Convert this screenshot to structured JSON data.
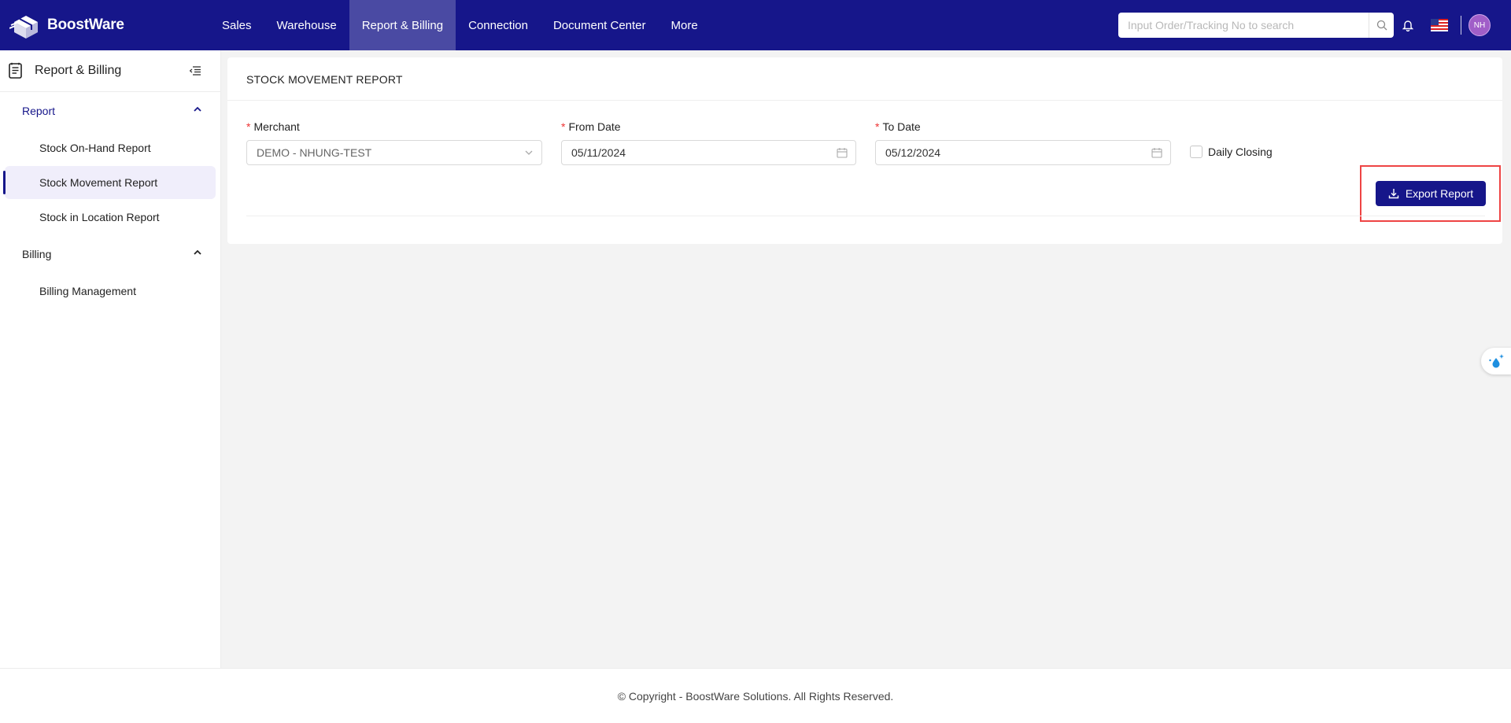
{
  "app": {
    "name": "BoostWare"
  },
  "nav": {
    "items": [
      {
        "label": "Sales"
      },
      {
        "label": "Warehouse"
      },
      {
        "label": "Report & Billing",
        "active": true
      },
      {
        "label": "Connection"
      },
      {
        "label": "Document Center"
      },
      {
        "label": "More"
      }
    ]
  },
  "search": {
    "placeholder": "Input Order/Tracking No to search",
    "value": ""
  },
  "user": {
    "initials": "NH"
  },
  "sidebar": {
    "title": "Report & Billing",
    "groups": [
      {
        "label": "Report",
        "items": [
          {
            "label": "Stock On-Hand Report"
          },
          {
            "label": "Stock Movement Report",
            "active": true
          },
          {
            "label": "Stock in Location Report"
          }
        ]
      },
      {
        "label": "Billing",
        "items": [
          {
            "label": "Billing Management"
          }
        ]
      }
    ]
  },
  "main": {
    "title": "STOCK MOVEMENT REPORT",
    "fields": {
      "merchant": {
        "label": "Merchant",
        "value": "DEMO - NHUNG-TEST"
      },
      "from_date": {
        "label": "From Date",
        "value": "05/11/2024"
      },
      "to_date": {
        "label": "To Date",
        "value": "05/12/2024"
      },
      "daily_closing": {
        "label": "Daily Closing",
        "checked": false
      }
    },
    "export_label": "Export Report"
  },
  "footer": {
    "text": "© Copyright - BoostWare Solutions. All Rights Reserved."
  },
  "colors": {
    "primary": "#16168a",
    "nav_active": "#4a4aa3",
    "required": "#e33333",
    "highlight": "#e44444",
    "avatar": "#a05ec8"
  }
}
